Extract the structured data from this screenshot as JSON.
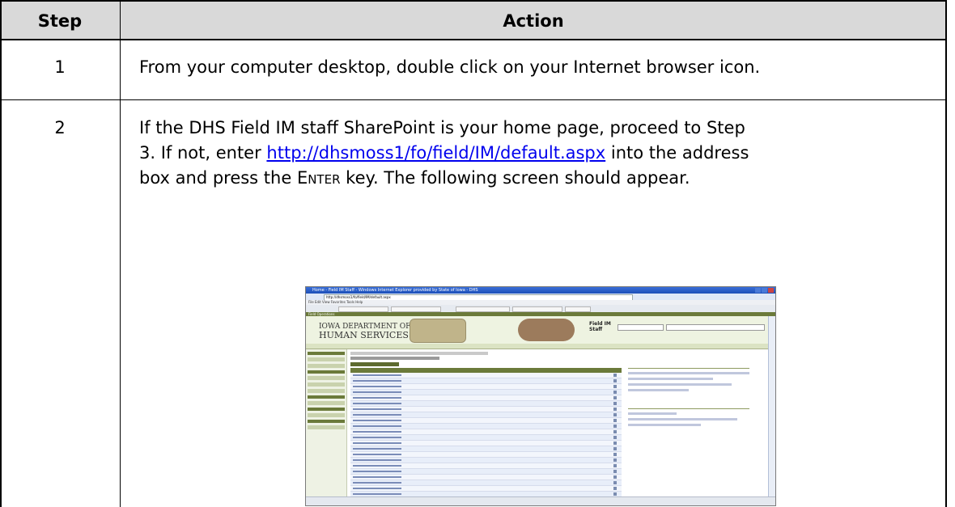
{
  "table": {
    "headers": {
      "step": "Step",
      "action": "Action"
    },
    "rows": [
      {
        "step": "1",
        "text": "From your computer desktop, double click on your Internet browser icon."
      },
      {
        "step": "2",
        "line1": "If the DHS Field IM staff SharePoint is your home page, proceed to Step",
        "line2_a": "3.  If not, enter ",
        "link": "http://dhsmoss1/fo/field/IM/default.aspx",
        "line2_b": " into the address",
        "line3_a": "box and press the ",
        "key": "Enter",
        "line3_b": " key.  The following screen should appear."
      }
    ]
  },
  "screenshot": {
    "window_title": "Home - Field IM Staff - Windows Internet Explorer provided by State of Iowa - DHS",
    "address": "http://dhsmoss1/fo/field/IM/default.aspx",
    "menu": "File  Edit  View  Favorites  Tools  Help",
    "site_bar": "Field Operations",
    "logo_line1": "IOWA DEPARTMENT OF",
    "logo_line2": "HUMAN SERVICES",
    "field_label": "Field IM Staff"
  }
}
